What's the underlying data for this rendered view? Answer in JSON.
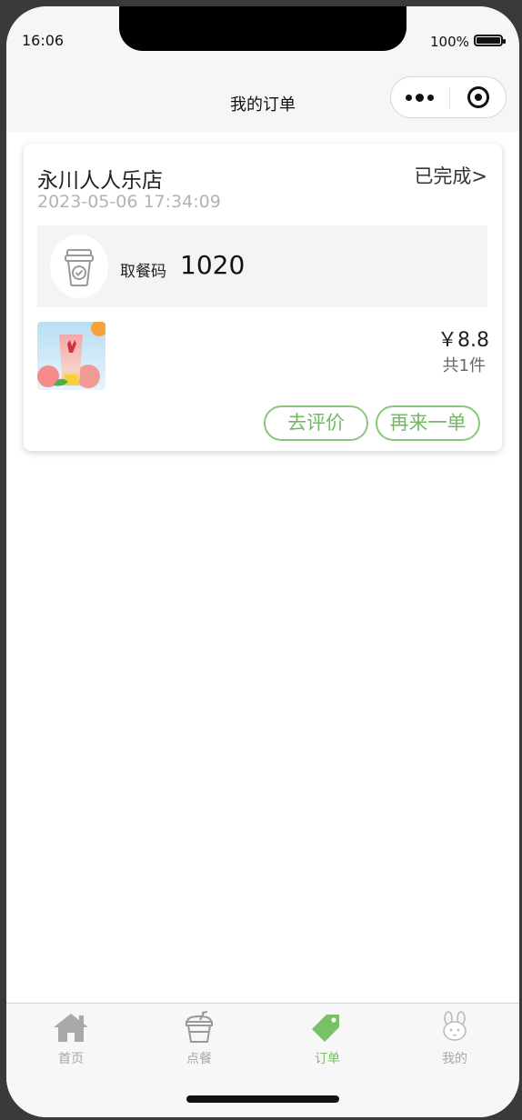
{
  "status_bar": {
    "time": "16:06",
    "battery": "100%"
  },
  "navbar": {
    "title": "我的订单"
  },
  "order": {
    "store": "永川人人乐店",
    "status": "已完成>",
    "datetime": "2023-05-06 17:34:09",
    "pickup_label": "取餐码",
    "pickup_code": "1020",
    "price": "￥8.8",
    "quantity": "共1件",
    "actions": {
      "review": "去评价",
      "reorder": "再来一单"
    }
  },
  "tabbar": {
    "items": [
      {
        "label": "首页",
        "icon": "house-icon"
      },
      {
        "label": "点餐",
        "icon": "drink-cup-icon"
      },
      {
        "label": "订单",
        "icon": "tag-icon",
        "active": true
      },
      {
        "label": "我的",
        "icon": "rabbit-icon"
      }
    ]
  },
  "colors": {
    "accent": "#78c265",
    "button_border": "#8ac77a",
    "background": "#ffffff"
  }
}
